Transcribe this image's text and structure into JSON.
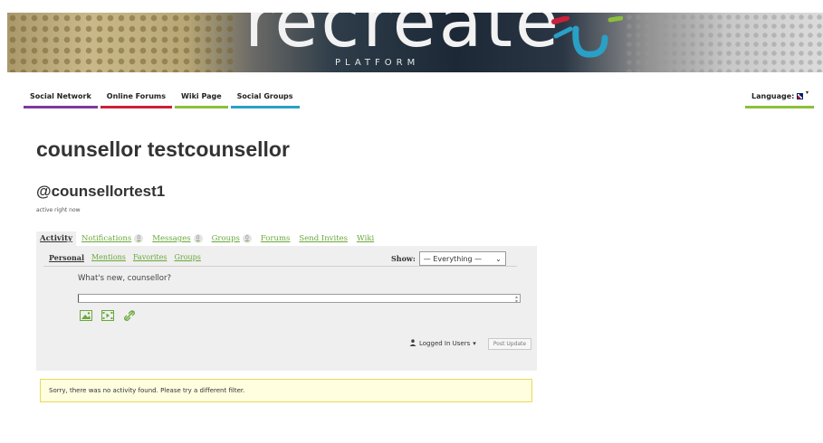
{
  "banner": {
    "brand": "recreate",
    "subtitle": "PLATFORM"
  },
  "nav": {
    "items": [
      {
        "label": "Social Network"
      },
      {
        "label": "Online Forums"
      },
      {
        "label": "Wiki Page"
      },
      {
        "label": "Social Groups"
      }
    ],
    "language_label": "Language:"
  },
  "profile": {
    "name": "counsellor testcounsellor",
    "handle": "@counsellortest1",
    "status": "active right now"
  },
  "tabs": [
    {
      "label": "Activity",
      "count": ""
    },
    {
      "label": "Notifications",
      "count": "0"
    },
    {
      "label": "Messages",
      "count": "0"
    },
    {
      "label": "Groups",
      "count": "0"
    },
    {
      "label": "Forums",
      "count": ""
    },
    {
      "label": "Send Invites",
      "count": ""
    },
    {
      "label": "Wiki",
      "count": ""
    }
  ],
  "subnav": [
    "Personal",
    "Mentions",
    "Favorites",
    "Groups"
  ],
  "filter": {
    "label": "Show:",
    "selected": "— Everything —"
  },
  "post_form": {
    "prompt": "What's new, counsellor?",
    "value": "",
    "visibility": "Logged In Users",
    "submit_label": "Post Update"
  },
  "notice": "Sorry, there was no activity found. Please try a different filter.",
  "colors": {
    "link": "#6aa83a",
    "nav_social_network": "#7b3a9d",
    "nav_online_forums": "#cc1f3a",
    "nav_wiki_page": "#8cbf3a",
    "nav_social_groups": "#2aa0c7",
    "notice_bg": "#ffffe0"
  }
}
